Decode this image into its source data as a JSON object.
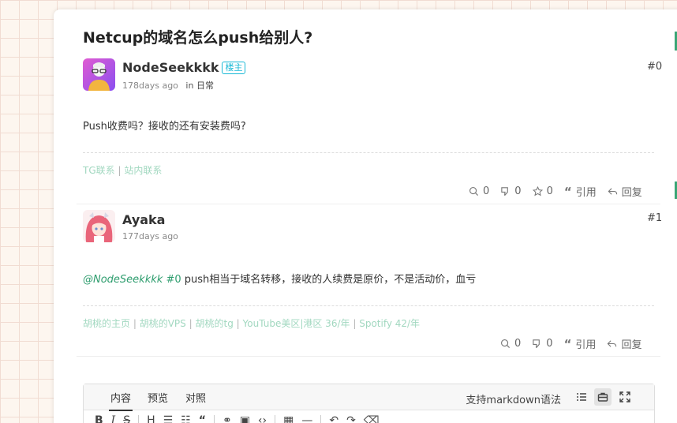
{
  "topic": {
    "title": "Netcup的域名怎么push给别人?"
  },
  "posts": [
    {
      "author": "NodeSeekkkk",
      "badge": "楼主",
      "time": "178days ago",
      "in_label": "in",
      "category": "日常",
      "floor": "#0",
      "content": "Push收费吗？接收的还有安装费吗?",
      "signature": [
        "TG联系",
        "站内联系"
      ],
      "sig_sep": "|",
      "likes": "0",
      "dislikes": "0",
      "stars": "0",
      "quote_label": "引用",
      "reply_label": "回复"
    },
    {
      "author": "Ayaka",
      "time": "177days ago",
      "floor": "#1",
      "mention": "@NodeSeekkkk",
      "mention_floor": "#0",
      "content": " push相当于域名转移，接收的人续费是原价，不是活动价，血亏",
      "signature": [
        "胡桃的主页",
        "胡桃的VPS",
        "胡桃的tg",
        "YouTube美区|港区 36/年",
        "Spotify 42/年"
      ],
      "sig_sep": "|",
      "likes": "0",
      "dislikes": "0",
      "quote_label": "引用",
      "reply_label": "回复"
    }
  ],
  "editor": {
    "tabs": [
      "内容",
      "预览",
      "对照"
    ],
    "active_tab": "内容",
    "markdown_tip": "支持markdown语法",
    "toolbar": [
      "bold-icon",
      "italic-icon",
      "strikethrough-icon",
      "heading-icon",
      "unordered-list-icon",
      "ordered-list-icon",
      "quote-icon",
      "link-icon",
      "image-icon",
      "code-icon",
      "table-icon",
      "horizontal-rule-icon",
      "undo-icon",
      "redo-icon",
      "eraser-icon"
    ]
  },
  "colors": {
    "accent": "#2e9d6e",
    "badge": "#19b9d6",
    "signature": "#a2d8c0"
  }
}
